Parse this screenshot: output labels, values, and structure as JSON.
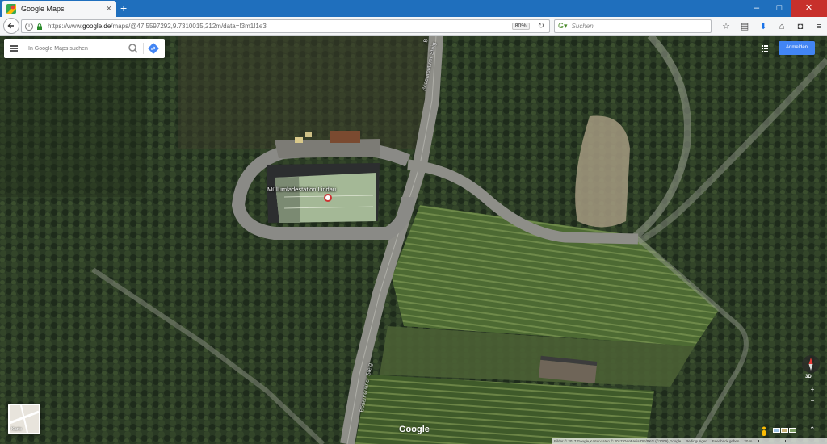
{
  "browser": {
    "tab_title": "Google Maps",
    "url_prefix": "https://www.",
    "url_domain": "google.de",
    "url_rest": "/maps/@47.5597292,9.7310015,212m/data=!3m1!1e3",
    "zoom": "80%",
    "search_placeholder": "Suchen"
  },
  "maps": {
    "search_placeholder": "In Google Maps suchen",
    "sign_in_label": "Anmelden",
    "place_label": "Müllumladestation Lindau",
    "road_labels": [
      "Bösenreutiner Steig",
      "Bösenreutiner Steig",
      "B"
    ],
    "logo_text": "Google",
    "basemap_thumb_label": "Karte",
    "control_3d": "3D",
    "zoom_in": "+",
    "zoom_out": "−",
    "footer": {
      "attribution": "Bilder © 2017 Google,Kartendaten © 2017 GeoBasis-DE/BKG (©2009),Google",
      "terms": "Bedingungen",
      "feedback": "Feedback geben",
      "scale": "20 m"
    }
  },
  "colors": {
    "tabbar": "#1f6fbd",
    "sign_in": "#4285f4",
    "forest_dark": "#263321",
    "field": "#4f6b34"
  }
}
